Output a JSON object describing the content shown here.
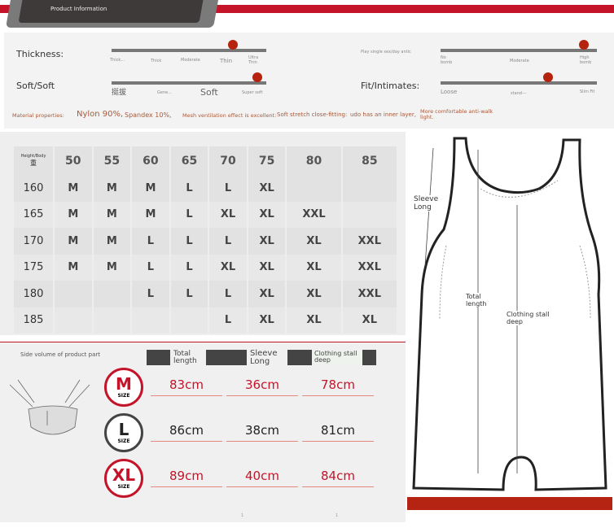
{
  "header": {
    "title": "Product Information",
    "accent": "#c4142a"
  },
  "specs": {
    "thickness": {
      "label": "Thickness:",
      "ticks": [
        "Thick...",
        "Thick",
        "Moderate",
        "Thin",
        "Ultra Thin"
      ],
      "level": 0.93
    },
    "softness": {
      "label": "Soft/Soft",
      "ticks": [
        "挺拔",
        "Gene...",
        "Soft",
        "Super soft"
      ],
      "level": 0.97
    },
    "elasticity": {
      "label": "Play single sex/day antic",
      "ticks": [
        "No bomb",
        "Moderate",
        "High bomb"
      ],
      "level": 0.98
    },
    "fit": {
      "label": "Fit/Intimates:",
      "ticks": [
        "Loose",
        "stand---",
        "Slim Fit"
      ],
      "level": 0.68
    },
    "material": [
      "Material properties:",
      "Nylon 90%,",
      "Spandex 10%,",
      "Mesh ventilation effect is excellent:",
      "Soft stretch close-fitting:",
      "udo has an inner layer,",
      "More comfortable anti-walk light."
    ]
  },
  "size_table": {
    "corner": "Height/Body",
    "corner_sub": "重",
    "weights": [
      "50",
      "55",
      "60",
      "65",
      "70",
      "75",
      "80",
      "85"
    ],
    "rows": [
      {
        "height": "160",
        "sizes": [
          "M",
          "M",
          "M",
          "L",
          "L",
          "XL",
          "",
          ""
        ]
      },
      {
        "height": "165",
        "sizes": [
          "M",
          "M",
          "M",
          "L",
          "XL",
          "XL",
          "XXL",
          ""
        ]
      },
      {
        "height": "170",
        "sizes": [
          "M",
          "M",
          "L",
          "L",
          "L",
          "XL",
          "XL",
          "XXL"
        ]
      },
      {
        "height": "175",
        "sizes": [
          "M",
          "M",
          "L",
          "L",
          "XL",
          "XL",
          "XL",
          "XXL"
        ]
      },
      {
        "height": "180",
        "sizes": [
          "",
          "",
          "L",
          "L",
          "L",
          "XL",
          "XL",
          "XXL"
        ]
      },
      {
        "height": "185",
        "sizes": [
          "",
          "",
          "",
          "",
          "L",
          "XL",
          "XL",
          "XL"
        ]
      }
    ]
  },
  "measurements": {
    "caption": "Side volume of product part",
    "columns": [
      "Total length",
      "Sleeve Long",
      "Clothing stall deep"
    ],
    "size_word": "SIZE",
    "rows": [
      {
        "size": "M",
        "values": [
          "83cm",
          "36cm",
          "78cm"
        ],
        "color": "#c4142a"
      },
      {
        "size": "L",
        "values": [
          "86cm",
          "38cm",
          "81cm"
        ],
        "color": "#222222"
      },
      {
        "size": "XL",
        "values": [
          "89cm",
          "40cm",
          "84cm"
        ],
        "color": "#c4142a"
      }
    ],
    "footnotes": [
      "1",
      "1"
    ]
  },
  "garment": {
    "sleeve": "Sleeve Long",
    "total": "Total length",
    "deep": "Clothing stall deep"
  }
}
